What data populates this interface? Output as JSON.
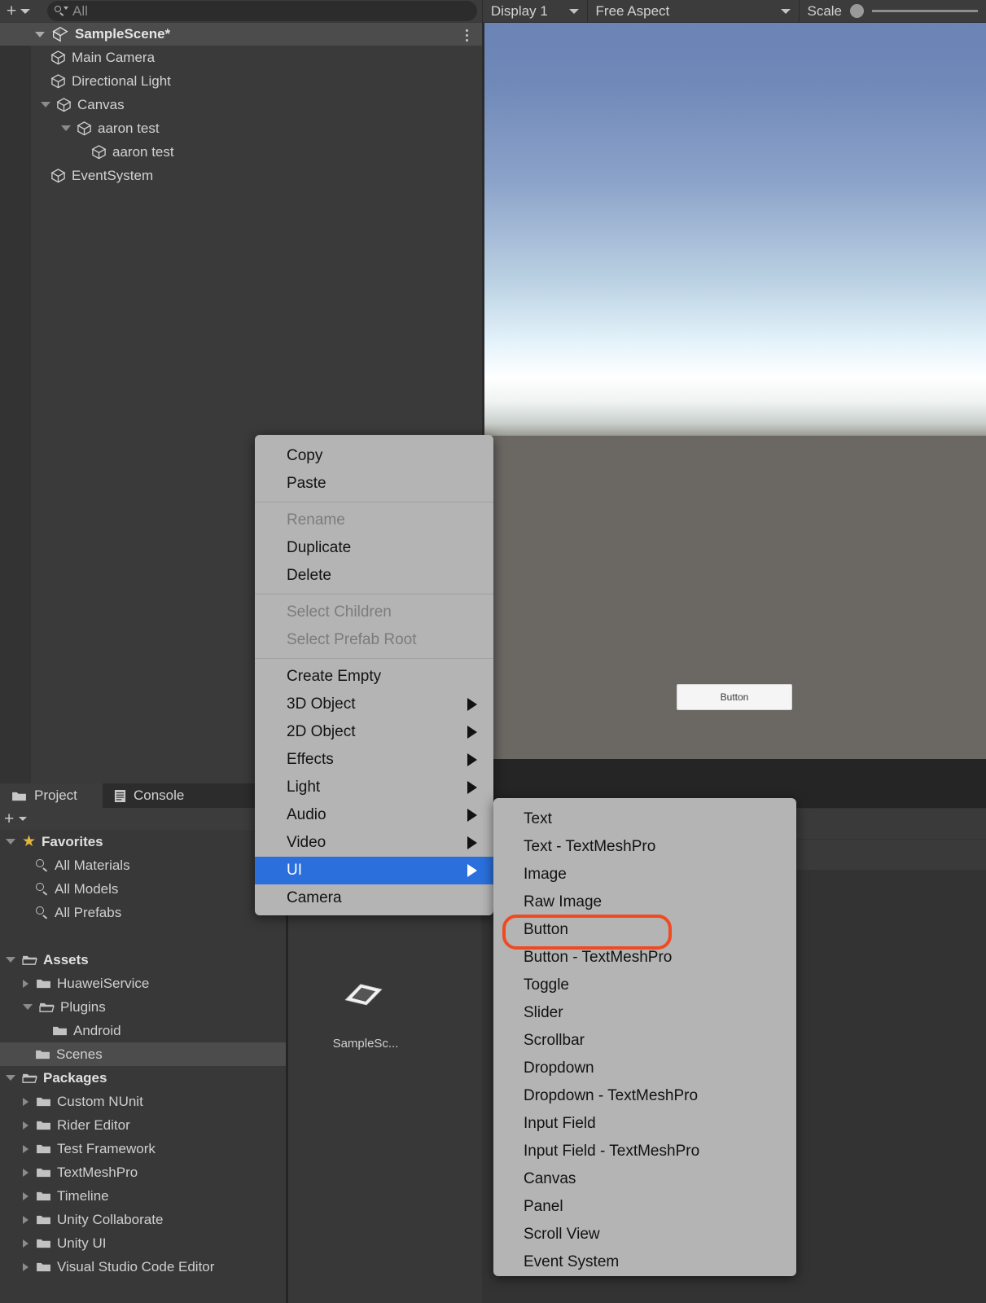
{
  "hierarchy": {
    "toolbar": {
      "add_icon": "plus-icon",
      "add_dropdown_icon": "chevron-down-icon",
      "search_icon": "search-icon",
      "search_value": "",
      "search_placeholder": "All"
    },
    "scene": {
      "name": "SampleScene*",
      "expanded": true,
      "menu_icon": "kebab-menu-icon"
    },
    "items": [
      {
        "label": "Main Camera",
        "depth": 1,
        "expandable": false
      },
      {
        "label": "Directional Light",
        "depth": 1,
        "expandable": false
      },
      {
        "label": "Canvas",
        "depth": 1,
        "expandable": true
      },
      {
        "label": "aaron test",
        "depth": 2,
        "expandable": true
      },
      {
        "label": "aaron test",
        "depth": 3,
        "expandable": false
      },
      {
        "label": "EventSystem",
        "depth": 1,
        "expandable": false
      }
    ]
  },
  "gameview": {
    "display": "Display 1",
    "aspect": "Free Aspect",
    "scale_label": "Scale",
    "scale_value": 1,
    "button_label": "Button",
    "sky_top_color": "#6b83b5",
    "ground_color": "#6b6763"
  },
  "project": {
    "tabs": [
      {
        "label": "Project",
        "icon": "folder-icon",
        "active": true
      },
      {
        "label": "Console",
        "icon": "console-icon",
        "active": false
      }
    ],
    "toolbar": {
      "add_icon": "plus-icon",
      "add_dropdown_icon": "chevron-down-icon"
    },
    "tree": [
      {
        "label": "Favorites",
        "depth": 0,
        "icon": "star-icon",
        "arrow": "down",
        "bold": true,
        "selected": false
      },
      {
        "label": "All Materials",
        "depth": 1,
        "icon": "search-icon",
        "arrow": "none",
        "bold": false,
        "selected": false
      },
      {
        "label": "All Models",
        "depth": 1,
        "icon": "search-icon",
        "arrow": "none",
        "bold": false,
        "selected": false
      },
      {
        "label": "All Prefabs",
        "depth": 1,
        "icon": "search-icon",
        "arrow": "none",
        "bold": false,
        "selected": false
      },
      {
        "label": "",
        "depth": 0,
        "icon": "none",
        "arrow": "none",
        "bold": false,
        "selected": false
      },
      {
        "label": "Assets",
        "depth": 0,
        "icon": "folder-open-icon",
        "arrow": "down",
        "bold": true,
        "selected": false
      },
      {
        "label": "HuaweiService",
        "depth": 1,
        "icon": "folder-icon",
        "arrow": "right",
        "bold": false,
        "selected": false
      },
      {
        "label": "Plugins",
        "depth": 1,
        "icon": "folder-open-icon",
        "arrow": "down",
        "bold": false,
        "selected": false
      },
      {
        "label": "Android",
        "depth": 2,
        "icon": "folder-icon",
        "arrow": "none",
        "bold": false,
        "selected": false
      },
      {
        "label": "Scenes",
        "depth": 1,
        "icon": "folder-icon",
        "arrow": "none",
        "bold": false,
        "selected": true
      },
      {
        "label": "Packages",
        "depth": 0,
        "icon": "folder-open-icon",
        "arrow": "down",
        "bold": true,
        "selected": false
      },
      {
        "label": "Custom NUnit",
        "depth": 1,
        "icon": "folder-icon",
        "arrow": "right",
        "bold": false,
        "selected": false
      },
      {
        "label": "Rider Editor",
        "depth": 1,
        "icon": "folder-icon",
        "arrow": "right",
        "bold": false,
        "selected": false
      },
      {
        "label": "Test Framework",
        "depth": 1,
        "icon": "folder-icon",
        "arrow": "right",
        "bold": false,
        "selected": false
      },
      {
        "label": "TextMeshPro",
        "depth": 1,
        "icon": "folder-icon",
        "arrow": "right",
        "bold": false,
        "selected": false
      },
      {
        "label": "Timeline",
        "depth": 1,
        "icon": "folder-icon",
        "arrow": "right",
        "bold": false,
        "selected": false
      },
      {
        "label": "Unity Collaborate",
        "depth": 1,
        "icon": "folder-icon",
        "arrow": "right",
        "bold": false,
        "selected": false
      },
      {
        "label": "Unity UI",
        "depth": 1,
        "icon": "folder-icon",
        "arrow": "right",
        "bold": false,
        "selected": false
      },
      {
        "label": "Visual Studio Code Editor",
        "depth": 1,
        "icon": "folder-icon",
        "arrow": "right",
        "bold": false,
        "selected": false
      }
    ],
    "asset": {
      "name": "SampleSc...",
      "icon": "unity-scene-icon"
    }
  },
  "context_menu": {
    "items": [
      {
        "label": "Copy",
        "disabled": false,
        "submenu": false,
        "selected": false
      },
      {
        "label": "Paste",
        "disabled": false,
        "submenu": false,
        "selected": false
      },
      {
        "separator": true
      },
      {
        "label": "Rename",
        "disabled": true,
        "submenu": false,
        "selected": false
      },
      {
        "label": "Duplicate",
        "disabled": false,
        "submenu": false,
        "selected": false
      },
      {
        "label": "Delete",
        "disabled": false,
        "submenu": false,
        "selected": false
      },
      {
        "separator": true
      },
      {
        "label": "Select Children",
        "disabled": true,
        "submenu": false,
        "selected": false
      },
      {
        "label": "Select Prefab Root",
        "disabled": true,
        "submenu": false,
        "selected": false
      },
      {
        "separator": true
      },
      {
        "label": "Create Empty",
        "disabled": false,
        "submenu": false,
        "selected": false
      },
      {
        "label": "3D Object",
        "disabled": false,
        "submenu": true,
        "selected": false
      },
      {
        "label": "2D Object",
        "disabled": false,
        "submenu": true,
        "selected": false
      },
      {
        "label": "Effects",
        "disabled": false,
        "submenu": true,
        "selected": false
      },
      {
        "label": "Light",
        "disabled": false,
        "submenu": true,
        "selected": false
      },
      {
        "label": "Audio",
        "disabled": false,
        "submenu": true,
        "selected": false
      },
      {
        "label": "Video",
        "disabled": false,
        "submenu": true,
        "selected": false
      },
      {
        "label": "UI",
        "disabled": false,
        "submenu": true,
        "selected": true
      },
      {
        "label": "Camera",
        "disabled": false,
        "submenu": false,
        "selected": false
      }
    ],
    "highlight_color": "#2a6fdb"
  },
  "ui_submenu": {
    "items": [
      {
        "label": "Text"
      },
      {
        "label": "Text - TextMeshPro"
      },
      {
        "label": "Image"
      },
      {
        "label": "Raw Image"
      },
      {
        "label": "Button",
        "annotated": true
      },
      {
        "label": "Button - TextMeshPro"
      },
      {
        "label": "Toggle"
      },
      {
        "label": "Slider"
      },
      {
        "label": "Scrollbar"
      },
      {
        "label": "Dropdown"
      },
      {
        "label": "Dropdown - TextMeshPro"
      },
      {
        "label": "Input Field"
      },
      {
        "label": "Input Field - TextMeshPro"
      },
      {
        "label": "Canvas"
      },
      {
        "label": "Panel"
      },
      {
        "label": "Scroll View"
      },
      {
        "label": "Event System"
      }
    ],
    "annotation_color": "#f04a22"
  }
}
